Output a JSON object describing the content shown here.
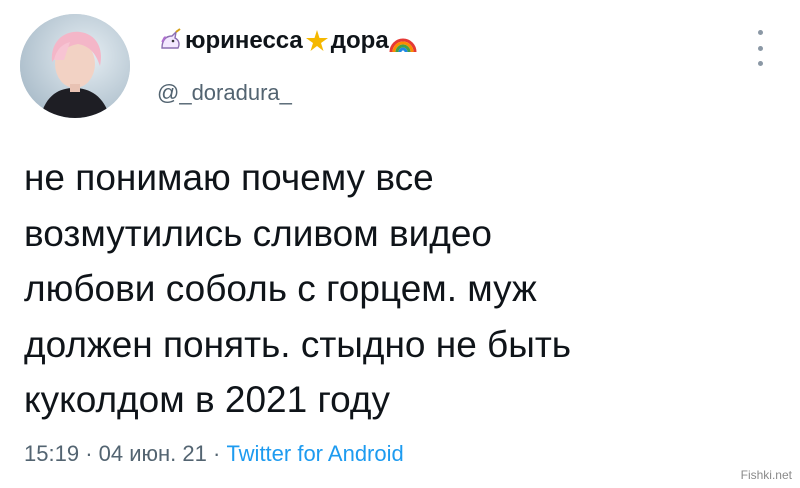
{
  "tweet": {
    "display_name": "юринесса",
    "display_name_part2": "дора",
    "name_emojis": [
      "unicorn-emoji",
      "star-emoji",
      "rainbow-emoji"
    ],
    "handle": "@_doradura_",
    "text_lines": [
      "не понимаю почему все",
      "возмутились сливом видео",
      "любови соболь с горцем. муж",
      "должен понять. стыдно не быть",
      "куколдом в 2021 году"
    ],
    "time": "15:19",
    "separator": "·",
    "date": "04 июн. 21",
    "source": "Twitter for Android"
  },
  "watermark": "Fishki.net",
  "colors": {
    "text": "#0f1419",
    "secondary": "#536471",
    "link": "#1d9bf0",
    "background": "#ffffff"
  }
}
